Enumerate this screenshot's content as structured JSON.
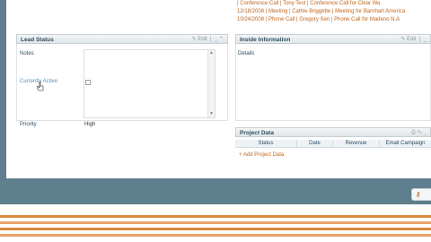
{
  "activity_rows": [
    {
      "date": "",
      "type": "Conference Call",
      "who": "Tony Test",
      "subject": "Conference Call for Clear Wa"
    },
    {
      "date": "12/18/2008",
      "type": "Meeting",
      "who": "Cathie Briggette",
      "subject": "Meeting for Barnhart America"
    },
    {
      "date": "10/24/2008",
      "type": "Phone Call",
      "who": "Gregory Sen",
      "subject": "Phone Call for Madeno N.A"
    }
  ],
  "lead_status": {
    "title": "Lead Status",
    "edit_label": "Edit",
    "notes_label": "Notes",
    "currently_active_label": "Currently Active",
    "priority_label": "Priority",
    "priority_value": "High"
  },
  "inside_info": {
    "title": "Inside Information",
    "edit_label": "Edit",
    "details_label": "Details"
  },
  "project_data": {
    "title": "Project Data",
    "columns": [
      "Status",
      "Date",
      "Revenue",
      "Email Campaign"
    ],
    "add_label": "Add Project Data"
  },
  "colors": {
    "accent": "#c0661c",
    "frame": "#5f7f8f",
    "header_text": "#2d4f63",
    "link": "#5a8fb6"
  }
}
